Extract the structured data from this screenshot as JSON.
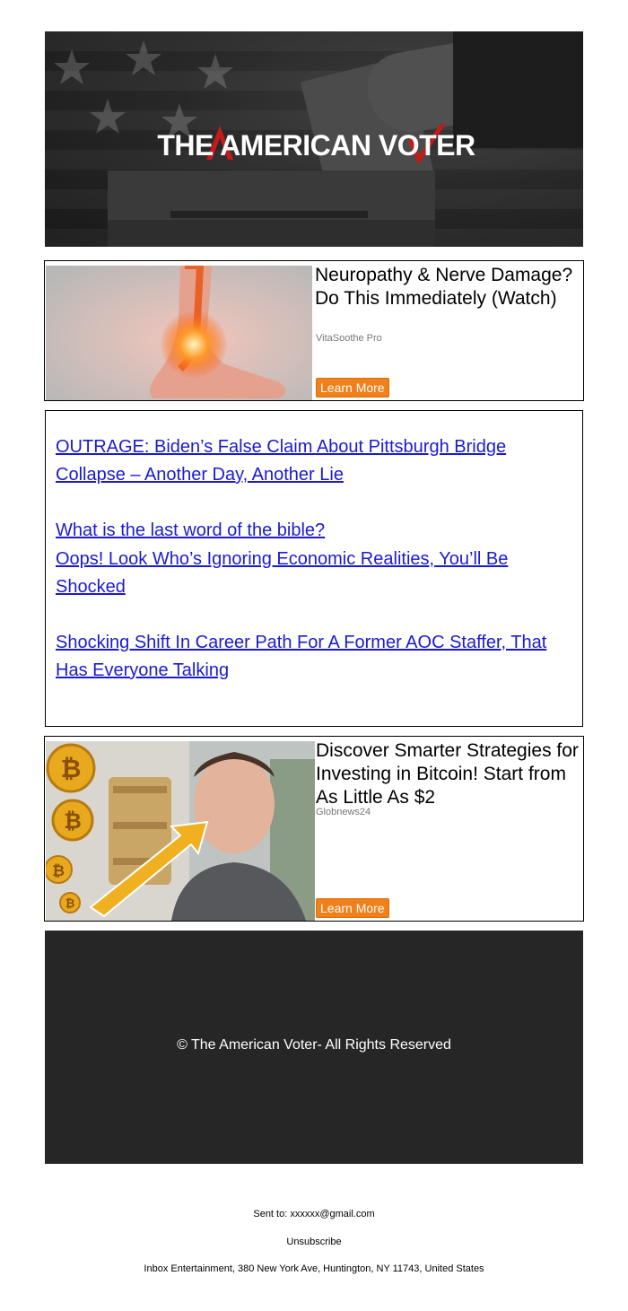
{
  "banner": {
    "logo_text": "THE AMERICAN VOTER",
    "colors": {
      "accent": "#c41a1a",
      "text": "#ffffff"
    }
  },
  "ads": [
    {
      "headline": "Neuropathy & Nerve Damage? Do This Immediately (Watch)",
      "source": "VitaSoothe Pro",
      "cta": "Learn More",
      "image": "foot-pain-image"
    },
    {
      "headline": "Discover Smarter Strategies for Investing in Bitcoin! Start from As Little As $2",
      "source": "Globnews24",
      "cta": "Learn More",
      "image": "bitcoin-investor-image"
    }
  ],
  "links": [
    {
      "text": "OUTRAGE: Biden’s False Claim About Pittsburgh Bridge Collapse – Another Day, Another Lie"
    },
    {
      "text": "What is the last word of the bible?"
    },
    {
      "text": "Oops! Look Who’s Ignoring Economic Realities, You’ll Be Shocked"
    },
    {
      "text": "Shocking Shift In Career Path For A Former AOC Staffer, That Has Everyone Talking"
    }
  ],
  "footer": {
    "copyright": "© The American Voter- All Rights Reserved"
  },
  "meta": {
    "sent_to": "Sent to: xxxxxx@gmail.com",
    "unsubscribe": "Unsubscribe",
    "address": "Inbox Entertainment, 380 New York Ave, Huntington, NY 11743, United States"
  },
  "colors": {
    "cta_bg": "#f08019",
    "link": "#1a1ad6",
    "footer_bg": "#262626"
  }
}
